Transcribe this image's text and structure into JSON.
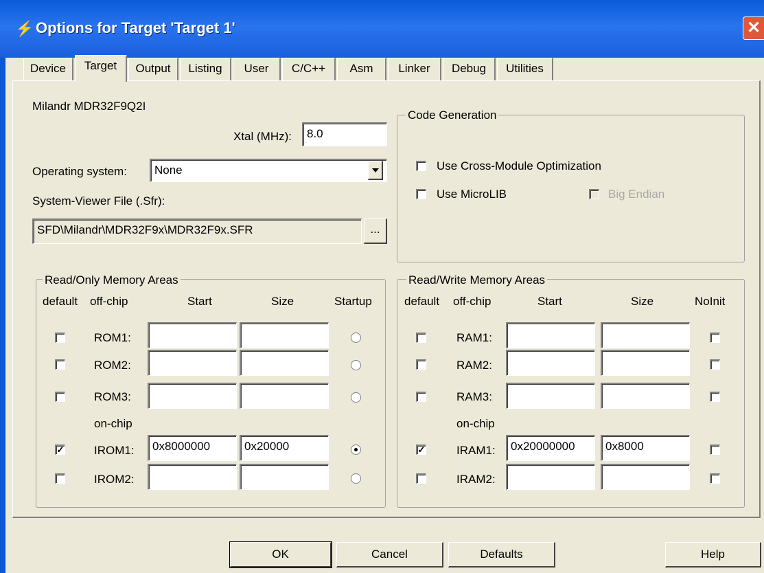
{
  "window": {
    "title": "Options for Target 'Target 1'",
    "icon": "keil-app-icon",
    "close_glyph": "✕"
  },
  "tabs": [
    {
      "label": "Device",
      "active": false
    },
    {
      "label": "Target",
      "active": true
    },
    {
      "label": "Output",
      "active": false
    },
    {
      "label": "Listing",
      "active": false
    },
    {
      "label": "User",
      "active": false
    },
    {
      "label": "C/C++",
      "active": false
    },
    {
      "label": "Asm",
      "active": false
    },
    {
      "label": "Linker",
      "active": false
    },
    {
      "label": "Debug",
      "active": false
    },
    {
      "label": "Utilities",
      "active": false
    }
  ],
  "target": {
    "device_name": "Milandr MDR32F9Q2I",
    "xtal_label": "Xtal (MHz):",
    "xtal_value": "8.0",
    "os_label": "Operating system:",
    "os_value": "None",
    "sfr_label": "System-Viewer File (.Sfr):",
    "sfr_value": "SFD\\Milandr\\MDR32F9x\\MDR32F9x.SFR",
    "browse_label": "..."
  },
  "code_generation": {
    "title": "Code Generation",
    "cross_module_label": "Use Cross-Module Optimization",
    "cross_module_checked": false,
    "microlib_label": "Use MicroLIB",
    "microlib_checked": false,
    "big_endian_label": "Big Endian",
    "big_endian_checked": false,
    "big_endian_enabled": false
  },
  "rom_areas": {
    "title": "Read/Only Memory Areas",
    "headers": {
      "default": "default",
      "offchip": "off-chip",
      "start": "Start",
      "size": "Size",
      "startup": "Startup"
    },
    "onchip_label": "on-chip",
    "rows": [
      {
        "label": "ROM1:",
        "default": false,
        "start": "",
        "size": "",
        "startup": false
      },
      {
        "label": "ROM2:",
        "default": false,
        "start": "",
        "size": "",
        "startup": false
      },
      {
        "label": "ROM3:",
        "default": false,
        "start": "",
        "size": "",
        "startup": false
      },
      {
        "label": "IROM1:",
        "default": true,
        "start": "0x8000000",
        "size": "0x20000",
        "startup": true
      },
      {
        "label": "IROM2:",
        "default": false,
        "start": "",
        "size": "",
        "startup": false
      }
    ]
  },
  "ram_areas": {
    "title": "Read/Write Memory Areas",
    "headers": {
      "default": "default",
      "offchip": "off-chip",
      "start": "Start",
      "size": "Size",
      "noinit": "NoInit"
    },
    "onchip_label": "on-chip",
    "rows": [
      {
        "label": "RAM1:",
        "default": false,
        "start": "",
        "size": "",
        "noinit": false
      },
      {
        "label": "RAM2:",
        "default": false,
        "start": "",
        "size": "",
        "noinit": false
      },
      {
        "label": "RAM3:",
        "default": false,
        "start": "",
        "size": "",
        "noinit": false
      },
      {
        "label": "IRAM1:",
        "default": true,
        "start": "0x20000000",
        "size": "0x8000",
        "noinit": false
      },
      {
        "label": "IRAM2:",
        "default": false,
        "start": "",
        "size": "",
        "noinit": false
      }
    ]
  },
  "buttons": {
    "ok": "OK",
    "cancel": "Cancel",
    "defaults": "Defaults",
    "help": "Help"
  },
  "colors": {
    "titlebar": "#1a5fdc",
    "dialog_bg": "#ece9d8",
    "close_button": "#e0573a"
  }
}
